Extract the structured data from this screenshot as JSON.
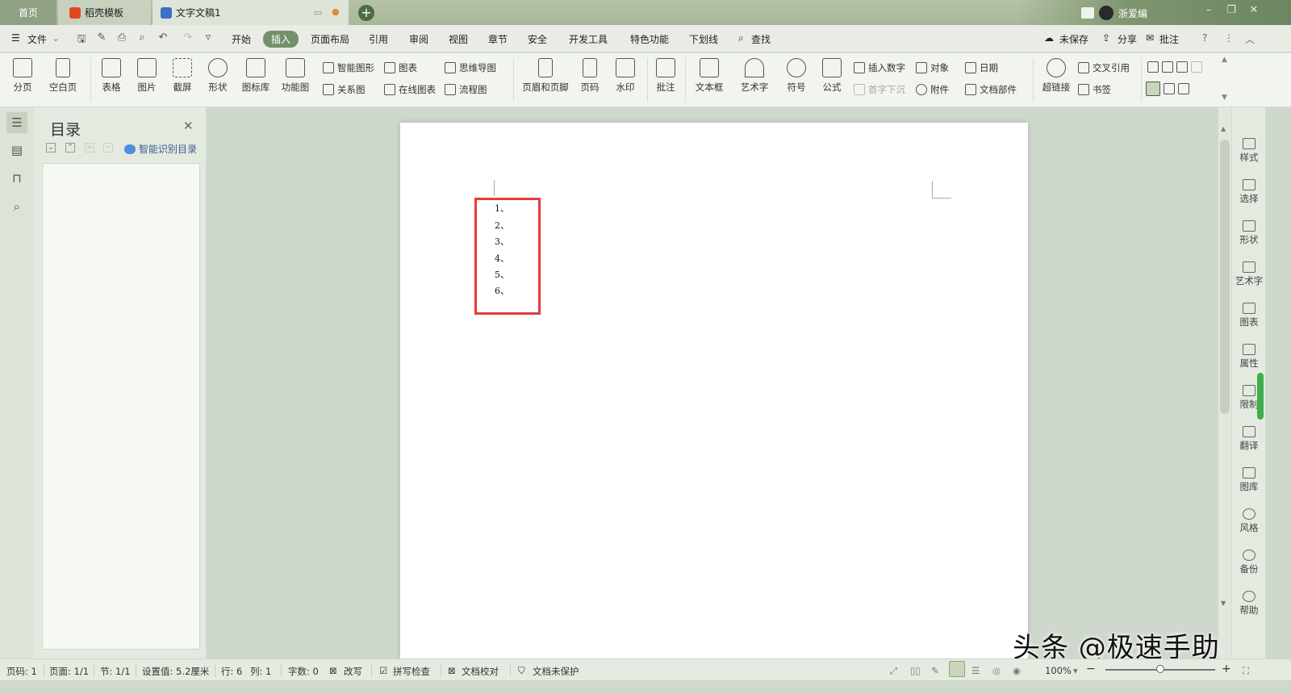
{
  "tabs": [
    {
      "label": "首页"
    },
    {
      "label": "稻壳模板"
    },
    {
      "label": "文字文稿1"
    }
  ],
  "user": {
    "name": "浙爱编"
  },
  "menu": {
    "file": "文件",
    "items": [
      "开始",
      "插入",
      "页面布局",
      "引用",
      "审阅",
      "视图",
      "章节",
      "安全",
      "开发工具",
      "特色功能",
      "下划线"
    ],
    "search": "查找",
    "unsaved": "未保存",
    "share": "分享",
    "comment": "批注"
  },
  "ribbon": {
    "page_break": "分页",
    "blank_page": "空白页",
    "table": "表格",
    "picture": "图片",
    "screenshot": "截屏",
    "shape": "形状",
    "icon_lib": "图标库",
    "func_chart": "功能图",
    "smart_shape": "智能图形",
    "chart": "图表",
    "mind_map": "思维导图",
    "relation": "关系图",
    "online_chart": "在线图表",
    "flowchart": "流程图",
    "header_footer": "页眉和页脚",
    "page_num": "页码",
    "watermark": "水印",
    "annotate": "批注",
    "textbox": "文本框",
    "wordart": "艺术字",
    "symbol": "符号",
    "formula": "公式",
    "insert_num": "插入数字",
    "object": "对象",
    "date": "日期",
    "drop_cap": "首字下沉",
    "attachment": "附件",
    "doc_parts": "文档部件",
    "hyperlink": "超链接",
    "cross_ref": "交叉引用",
    "bookmark": "书签"
  },
  "toc": {
    "title": "目录",
    "smart": "智能识别目录"
  },
  "document": {
    "list_items": [
      "1、",
      "2、",
      "3、",
      "4、",
      "5、",
      "6、"
    ]
  },
  "right_panel": [
    "样式",
    "选择",
    "形状",
    "艺术字",
    "图表",
    "属性",
    "限制",
    "翻译",
    "图库",
    "风格",
    "备份",
    "帮助"
  ],
  "status": {
    "page_num": "页码: 1",
    "pages": "页面: 1/1",
    "section": "节: 1/1",
    "setting": "设置值: 5.2厘米",
    "row": "行: 6",
    "col": "列: 1",
    "word_count": "字数: 0",
    "revise": "改写",
    "spell": "拼写检查",
    "proof": "文档校对",
    "protect": "文档未保护",
    "zoom": "100%",
    "zoom_level": 0.5
  },
  "watermark_text": "头条 @极速手助"
}
